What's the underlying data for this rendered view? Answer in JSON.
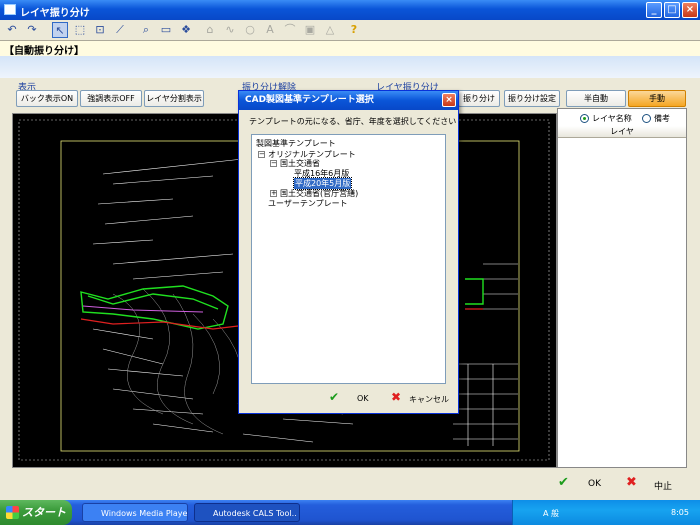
{
  "window": {
    "title": "レイヤ振り分け",
    "min": "_",
    "max": "□",
    "close": "×"
  },
  "mode_label": "【自動振り分け】",
  "display_group": {
    "label": "表示",
    "buttons": [
      "バック表示ON",
      "強調表示OFF",
      "レイヤ分割表示"
    ]
  },
  "group2_label": "振り分け解除",
  "group3_label": "レイヤ振り分け",
  "sort_buttons": {
    "assign": "振り分け",
    "settings": "振り分け設定",
    "semi": "半自動",
    "manual": "手動"
  },
  "right_panel": {
    "radio_name": "レイヤ名称",
    "radio_note": "備考",
    "column_header": "レイヤ"
  },
  "bottom": {
    "ok": "OK",
    "cancel": "中止"
  },
  "dialog": {
    "title": "CAD製図基準テンプレート選択",
    "instruction": "テンプレートの元になる、省庁、年度を選択してください",
    "tree": {
      "root": "製図基準テンプレート",
      "original": "オリジナルテンプレート",
      "mlit": "国土交通省",
      "h16": "平成16年6月版",
      "h20": "平成20年5月版",
      "mlit_building": "国土交通省(官庁営繕)",
      "user": "ユーザーテンプレート"
    },
    "ok": "OK",
    "cancel": "キャンセル"
  },
  "taskbar": {
    "start": "スタート",
    "tasks": [
      "Windows Media Player",
      "Autodesk CALS Tool.."
    ],
    "clock": "8:05",
    "ime": "A 般"
  },
  "colors": {
    "accent_orange": "#f5a623",
    "title_blue": "#0a55d8",
    "canvas_bg": "#000000"
  }
}
